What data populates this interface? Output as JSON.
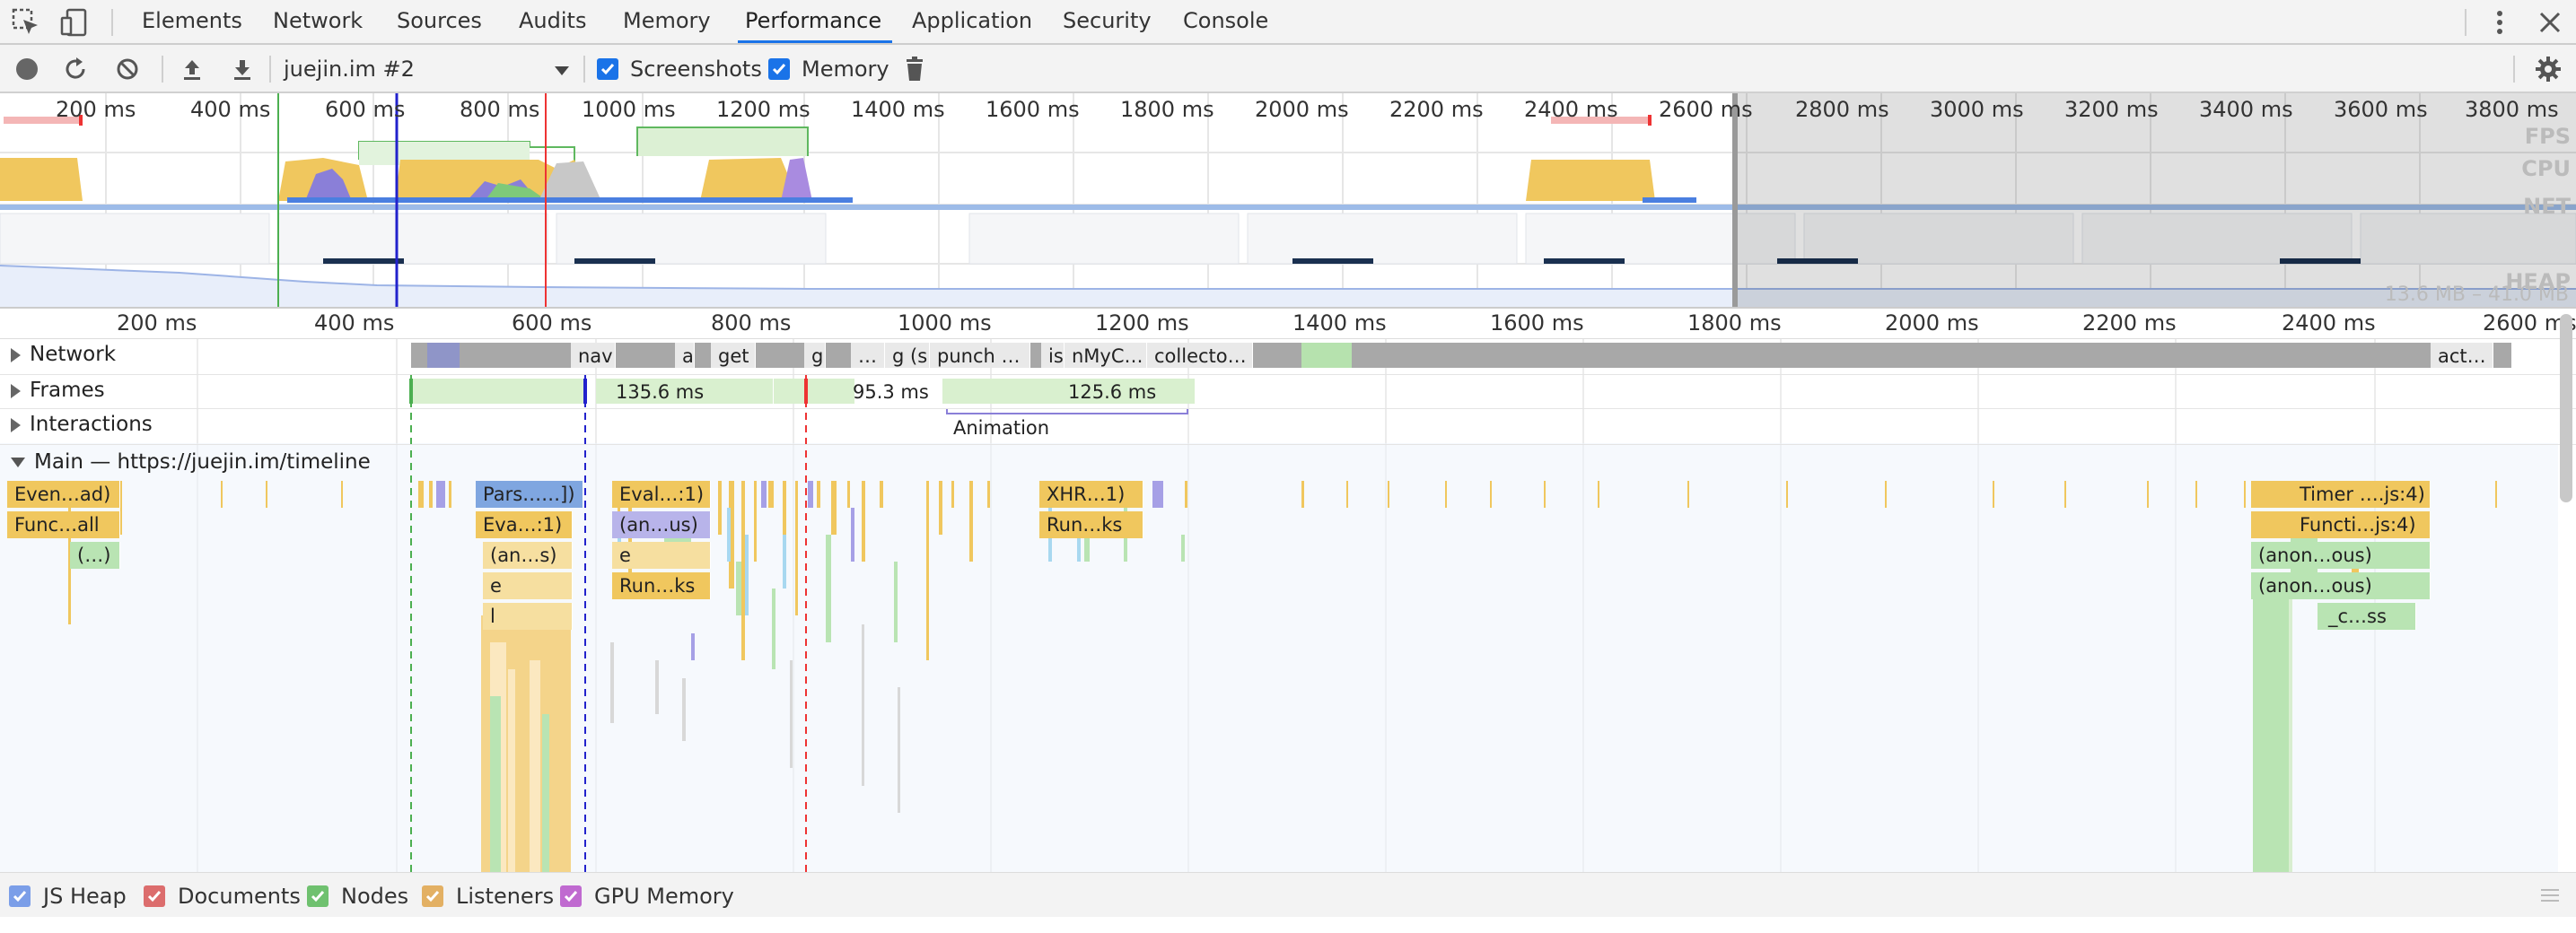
{
  "tabbar": {
    "tabs": [
      "Elements",
      "Network",
      "Sources",
      "Audits",
      "Memory",
      "Performance",
      "Application",
      "Security",
      "Console"
    ],
    "active": "Performance"
  },
  "toolbar": {
    "profile_select": "juejin.im #2",
    "screenshots_label": "Screenshots",
    "memory_label": "Memory"
  },
  "overview": {
    "ticks": [
      "200 ms",
      "400 ms",
      "600 ms",
      "800 ms",
      "1000 ms",
      "1200 ms",
      "1400 ms",
      "1600 ms",
      "1800 ms",
      "2000 ms",
      "2200 ms",
      "2400 ms",
      "2600 ms",
      "2800 ms",
      "3000 ms",
      "3200 ms",
      "3400 ms",
      "3600 ms",
      "3800 ms"
    ],
    "fps_label": "FPS",
    "cpu_label": "CPU",
    "net_label": "NET",
    "heap_label": "HEAP",
    "heap_range": "13.6 MB – 41.0 MB"
  },
  "timeline": {
    "ticks": [
      "200 ms",
      "400 ms",
      "600 ms",
      "800 ms",
      "1000 ms",
      "1200 ms",
      "1400 ms",
      "1600 ms",
      "1800 ms",
      "2000 ms",
      "2200 ms",
      "2400 ms",
      "2600 ms"
    ],
    "network_label": "Network",
    "frames_label": "Frames",
    "interactions_label": "Interactions",
    "main_label": "Main — https://juejin.im/timeline",
    "network_items": [
      "nav",
      "a",
      "get",
      "g",
      "…",
      "g (s…",
      "punch …",
      "is",
      "nMyC…",
      "collecto…",
      "act…"
    ],
    "frames": [
      "135.6 ms",
      "95.3 ms",
      "125.6 ms"
    ],
    "interaction": "Animation",
    "flame": {
      "left_stack": [
        "Even…ad)",
        "Func…all",
        "(…)"
      ],
      "a": [
        "Pars……])",
        "Eva…:1)",
        "(an…s)",
        "e",
        "l"
      ],
      "b": [
        "Eval…:1)",
        "(an…us)",
        "e",
        "Run…ks"
      ],
      "c": [
        "XHR…1)",
        "Run…ks"
      ],
      "d": [
        "Timer ….js:4)",
        "Functi…js:4)",
        "(anon…ous)",
        "(anon…ous)",
        "_c…ss"
      ]
    }
  },
  "legend": {
    "items": [
      {
        "label": "JS Heap",
        "color": "#4a7fe0"
      },
      {
        "label": "Documents",
        "color": "#d9534f"
      },
      {
        "label": "Nodes",
        "color": "#4caf50"
      },
      {
        "label": "Listeners",
        "color": "#e0a030"
      },
      {
        "label": "GPU Memory",
        "color": "#b040c0"
      }
    ]
  }
}
